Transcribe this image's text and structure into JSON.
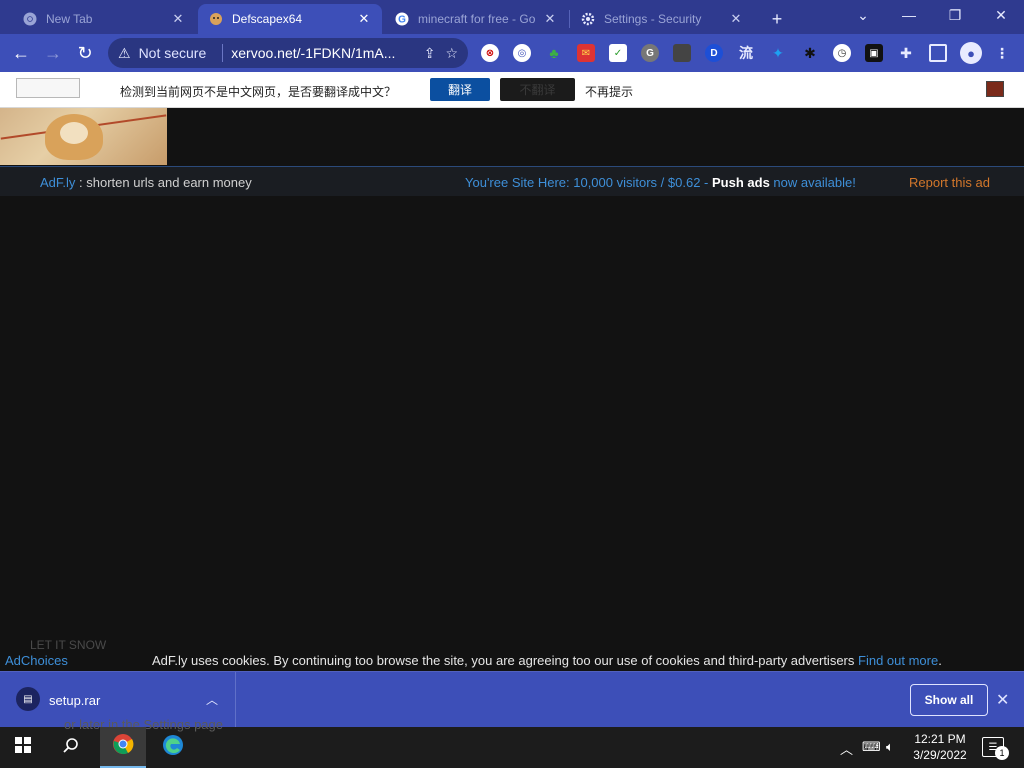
{
  "tabs": [
    {
      "title": "New Tab",
      "icon": "chrome-icon"
    },
    {
      "title": "Defscapex64",
      "icon": "doge-favicon"
    },
    {
      "title": "minecraft for free - Go",
      "icon": "google-icon"
    },
    {
      "title": "Settings - Security",
      "icon": "gear-icon"
    }
  ],
  "toolbar": {
    "security_label": "Not secure",
    "url": "xervoo.net/-1FDKN/1mA..."
  },
  "translate_bar": {
    "message": "检测到当前网页不是中文网页，是否要翻译成中文？",
    "translate_button": "翻译",
    "no_translate_button": "不翻译",
    "dont_ask": "不再提示"
  },
  "adfly_bar": {
    "brand": "AdF.ly",
    "tagline": ": shorten urls and earn money",
    "promo_prefix": "You'ree Site Here: 10,000 visitors / $0.62 -",
    "promo_bold": "Push ads",
    "promo_suffix": "now available!",
    "report": "Report this ad"
  },
  "page": {
    "ghost_text": "LET IT SNOW",
    "adchoices": "AdChoices",
    "cookie_text": "AdF.ly uses cookies. By continuing too browse the site, you are agreeing too our use of cookies and third-party advertisers",
    "cookie_link": "Find out more",
    "cookie_end": "."
  },
  "download_bar": {
    "filename": "setup.rar",
    "show_all": "Show all"
  },
  "taskbar": {
    "ghost_text": "or later in the Settings page",
    "time": "12:21 PM",
    "date": "3/29/2022",
    "notification_count": "1"
  },
  "colors": {
    "chrome_frame": "#2f3a8f",
    "chrome_toolbar": "#3d4fb8",
    "link_blue": "#3e8fd8",
    "report_orange": "#d2772b",
    "translate_blue": "#0b4fa0"
  }
}
